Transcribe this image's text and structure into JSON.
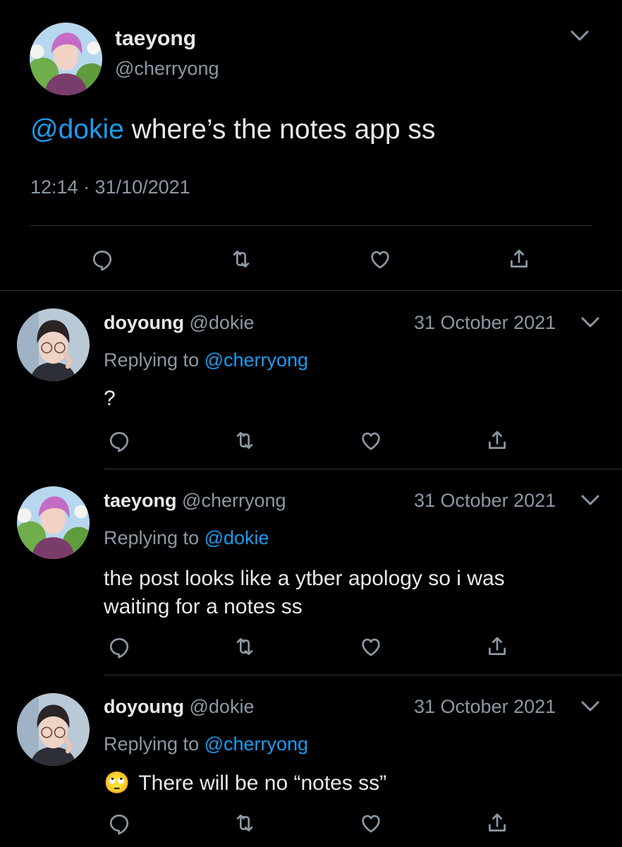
{
  "main_tweet": {
    "name": "taeyong",
    "handle": "@cherryong",
    "mention": "@dokie",
    "text": " where’s the notes app ss",
    "timestamp": "12:14 · 31/10/2021"
  },
  "replies": [
    {
      "name": "doyoung",
      "handle": "@dokie",
      "date": "31 October 2021",
      "replying_prefix": "Replying to ",
      "replying_to": "@cherryong",
      "text": "?"
    },
    {
      "name": "taeyong",
      "handle": "@cherryong",
      "date": "31 October 2021",
      "replying_prefix": "Replying to ",
      "replying_to": "@dokie",
      "text_line1": "the post looks like a ytber apology so i was",
      "text_line2": "waiting for a notes ss"
    },
    {
      "name": "doyoung",
      "handle": "@dokie",
      "date": "31 October 2021",
      "replying_prefix": "Replying to ",
      "replying_to": "@cherryong",
      "emoji": "🙄",
      "text": "There will be no “notes ss”"
    }
  ],
  "colors": {
    "background": "#000000",
    "text": "#e7e9ea",
    "muted": "#8b98a5",
    "accent": "#1d9bf0",
    "divider": "#2f3336"
  },
  "icons": [
    "reply-icon",
    "retweet-icon",
    "like-icon",
    "share-icon",
    "chevron-down-icon"
  ]
}
